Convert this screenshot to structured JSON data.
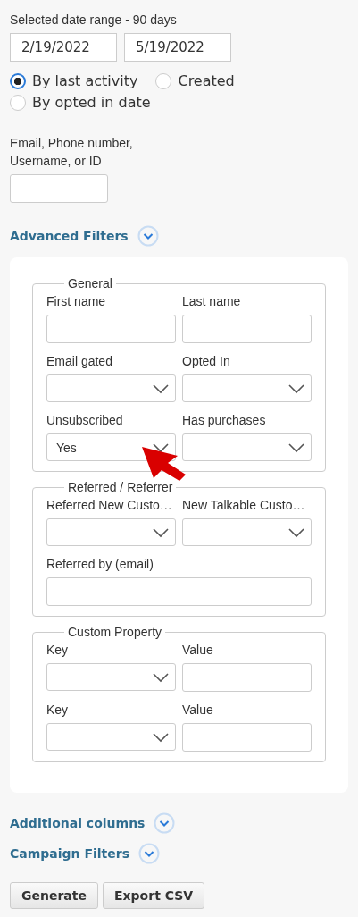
{
  "date_range": {
    "label": "Selected date range - 90 days",
    "start": "2/19/2022",
    "end": "5/19/2022"
  },
  "date_modes": [
    {
      "label": "By last activity",
      "selected": true
    },
    {
      "label": "Created",
      "selected": false
    },
    {
      "label": "By opted in date",
      "selected": false
    }
  ],
  "search": {
    "label": "Email, Phone number, Username, or ID"
  },
  "advanced_filters": {
    "label": "Advanced Filters",
    "fieldsets": [
      {
        "legend": "General",
        "fields": [
          {
            "label": "First name",
            "kind": "text"
          },
          {
            "label": "Last name",
            "kind": "text"
          },
          {
            "label": "Email gated",
            "kind": "select"
          },
          {
            "label": "Opted In",
            "kind": "select"
          },
          {
            "label": "Unsubscribed",
            "kind": "select",
            "value": "Yes"
          },
          {
            "label": "Has purchases",
            "kind": "select"
          }
        ]
      },
      {
        "legend": "Referred / Referrer",
        "fields": [
          {
            "label": "Referred New Custo…",
            "kind": "select"
          },
          {
            "label": "New Talkable Custo…",
            "kind": "select"
          },
          {
            "label": "Referred by (email)",
            "kind": "text",
            "wide": true
          }
        ]
      },
      {
        "legend": "Custom Property",
        "fields": [
          {
            "label": "Key",
            "kind": "select"
          },
          {
            "label": "Value",
            "kind": "text"
          },
          {
            "label": "Key",
            "kind": "select"
          },
          {
            "label": "Value",
            "kind": "text"
          }
        ]
      }
    ]
  },
  "sections": [
    {
      "label": "Additional columns",
      "expanded": false
    },
    {
      "label": "Campaign Filters",
      "expanded": false
    }
  ],
  "buttons": [
    "Generate",
    "Export CSV"
  ],
  "annotation": {
    "kind": "arrow"
  }
}
